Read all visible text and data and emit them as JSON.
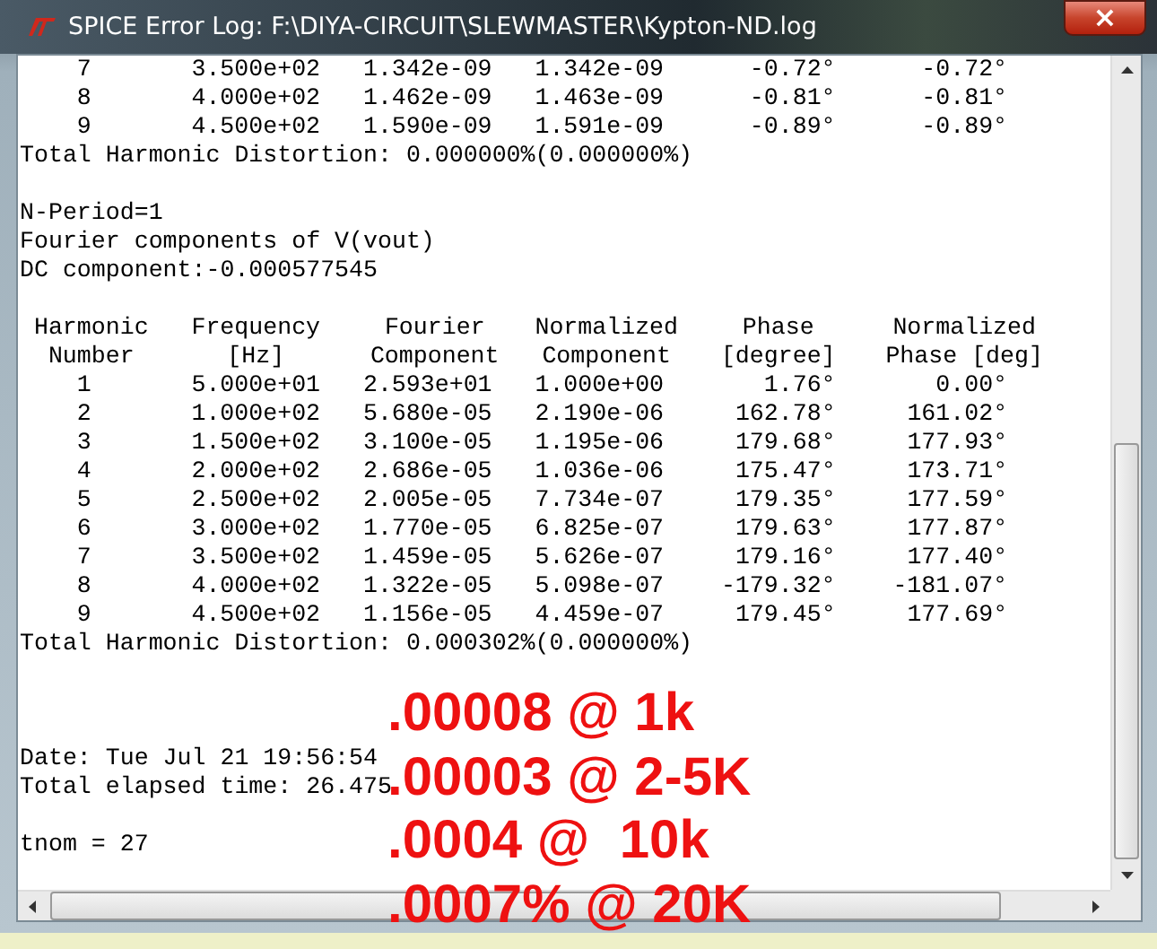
{
  "window": {
    "title": "SPICE Error Log: F:\\DIYA-CIRCUIT\\SLEWMASTER\\Kypton-ND.log",
    "close": "×"
  },
  "log": [
    {
      "kind": "row",
      "cells": [
        "7",
        "3.500e+02",
        "1.342e-09",
        "1.342e-09",
        "-0.72°",
        "-0.72°"
      ]
    },
    {
      "kind": "row",
      "cells": [
        "8",
        "4.000e+02",
        "1.462e-09",
        "1.463e-09",
        "-0.81°",
        "-0.81°"
      ]
    },
    {
      "kind": "row",
      "cells": [
        "9",
        "4.500e+02",
        "1.590e-09",
        "1.591e-09",
        "-0.89°",
        "-0.89°"
      ]
    },
    {
      "kind": "text",
      "text": "Total Harmonic Distortion: 0.000000%(0.000000%)"
    },
    {
      "kind": "blank"
    },
    {
      "kind": "text",
      "text": "N-Period=1"
    },
    {
      "kind": "text",
      "text": "Fourier components of V(vout)"
    },
    {
      "kind": "text",
      "text": "DC component:-0.000577545"
    },
    {
      "kind": "blank"
    },
    {
      "kind": "header",
      "cells": [
        "Harmonic",
        "Frequency",
        "Fourier",
        "Normalized",
        "Phase",
        "Normalized"
      ]
    },
    {
      "kind": "header",
      "cells": [
        "Number",
        "[Hz]",
        "Component",
        "Component",
        "[degree]",
        "Phase [deg]"
      ]
    },
    {
      "kind": "row",
      "cells": [
        "1",
        "5.000e+01",
        "2.593e+01",
        "1.000e+00",
        "1.76°",
        "0.00°"
      ]
    },
    {
      "kind": "row",
      "cells": [
        "2",
        "1.000e+02",
        "5.680e-05",
        "2.190e-06",
        "162.78°",
        "161.02°"
      ]
    },
    {
      "kind": "row",
      "cells": [
        "3",
        "1.500e+02",
        "3.100e-05",
        "1.195e-06",
        "179.68°",
        "177.93°"
      ]
    },
    {
      "kind": "row",
      "cells": [
        "4",
        "2.000e+02",
        "2.686e-05",
        "1.036e-06",
        "175.47°",
        "173.71°"
      ]
    },
    {
      "kind": "row",
      "cells": [
        "5",
        "2.500e+02",
        "2.005e-05",
        "7.734e-07",
        "179.35°",
        "177.59°"
      ]
    },
    {
      "kind": "row",
      "cells": [
        "6",
        "3.000e+02",
        "1.770e-05",
        "6.825e-07",
        "179.63°",
        "177.87°"
      ]
    },
    {
      "kind": "row",
      "cells": [
        "7",
        "3.500e+02",
        "1.459e-05",
        "5.626e-07",
        "179.16°",
        "177.40°"
      ]
    },
    {
      "kind": "row",
      "cells": [
        "8",
        "4.000e+02",
        "1.322e-05",
        "5.098e-07",
        "-179.32°",
        "-181.07°"
      ]
    },
    {
      "kind": "row",
      "cells": [
        "9",
        "4.500e+02",
        "1.156e-05",
        "4.459e-07",
        "179.45°",
        "177.69°"
      ]
    },
    {
      "kind": "text",
      "text": "Total Harmonic Distortion: 0.000302%(0.000000%)"
    },
    {
      "kind": "blank"
    },
    {
      "kind": "blank"
    },
    {
      "kind": "blank"
    },
    {
      "kind": "text",
      "text": "Date: Tue Jul 21 19:56:54"
    },
    {
      "kind": "text",
      "text": "Total elapsed time: 26.475"
    },
    {
      "kind": "blank"
    },
    {
      "kind": "text",
      "text": "tnom = 27"
    }
  ],
  "annotations": [
    ".00008 @ 1k",
    ".00003 @ 2-5K",
    ".0004 @  10k",
    ".0007% @ 20K"
  ]
}
